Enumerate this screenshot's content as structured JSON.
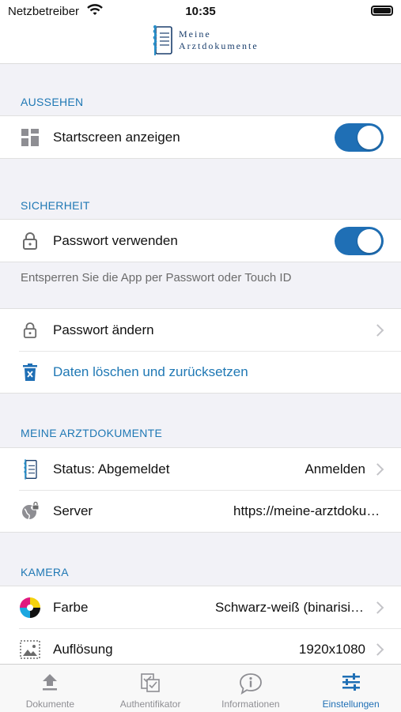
{
  "status_bar": {
    "carrier": "Netzbetreiber",
    "time": "10:35"
  },
  "header": {
    "logo_line1": "Meine",
    "logo_line2": "Arztdokumente"
  },
  "colors": {
    "accent": "#1f6fb5",
    "section_header": "#1f78b4"
  },
  "sections": {
    "aussehen": {
      "title": "AUSSEHEN",
      "startscreen": {
        "label": "Startscreen anzeigen",
        "icon": "grid-icon",
        "toggle_on": true
      }
    },
    "sicherheit": {
      "title": "SICHERHEIT",
      "passwort": {
        "label": "Passwort verwenden",
        "icon": "lock-icon",
        "toggle_on": true
      },
      "note": "Entsperren Sie die App per Passwort oder Touch ID",
      "passwort_aendern": {
        "label": "Passwort ändern",
        "icon": "lock-icon"
      },
      "daten_loeschen": {
        "label": "Daten löschen und zurücksetzen",
        "icon": "trash-icon"
      }
    },
    "meine_arztdokumente": {
      "title": "MEINE ARZTDOKUMENTE",
      "status": {
        "label": "Status: Abgemeldet",
        "value": "Anmelden",
        "icon": "document-logo-icon"
      },
      "server": {
        "label": "Server",
        "value": "https://meine-arztdokumente.de",
        "icon": "globe-lock-icon"
      }
    },
    "kamera": {
      "title": "KAMERA",
      "farbe": {
        "label": "Farbe",
        "value": "Schwarz-weiß (binarisiert)",
        "icon": "color-wheel-icon"
      },
      "aufloesung": {
        "label": "Auflösung",
        "value": "1920x1080",
        "icon": "image-icon"
      }
    }
  },
  "tabbar": {
    "tabs": [
      {
        "label": "Dokumente",
        "icon": "upload-icon",
        "active": false
      },
      {
        "label": "Authentifikator",
        "icon": "authenticator-icon",
        "active": false
      },
      {
        "label": "Informationen",
        "icon": "info-icon",
        "active": false
      },
      {
        "label": "Einstellungen",
        "icon": "sliders-icon",
        "active": true
      }
    ]
  }
}
